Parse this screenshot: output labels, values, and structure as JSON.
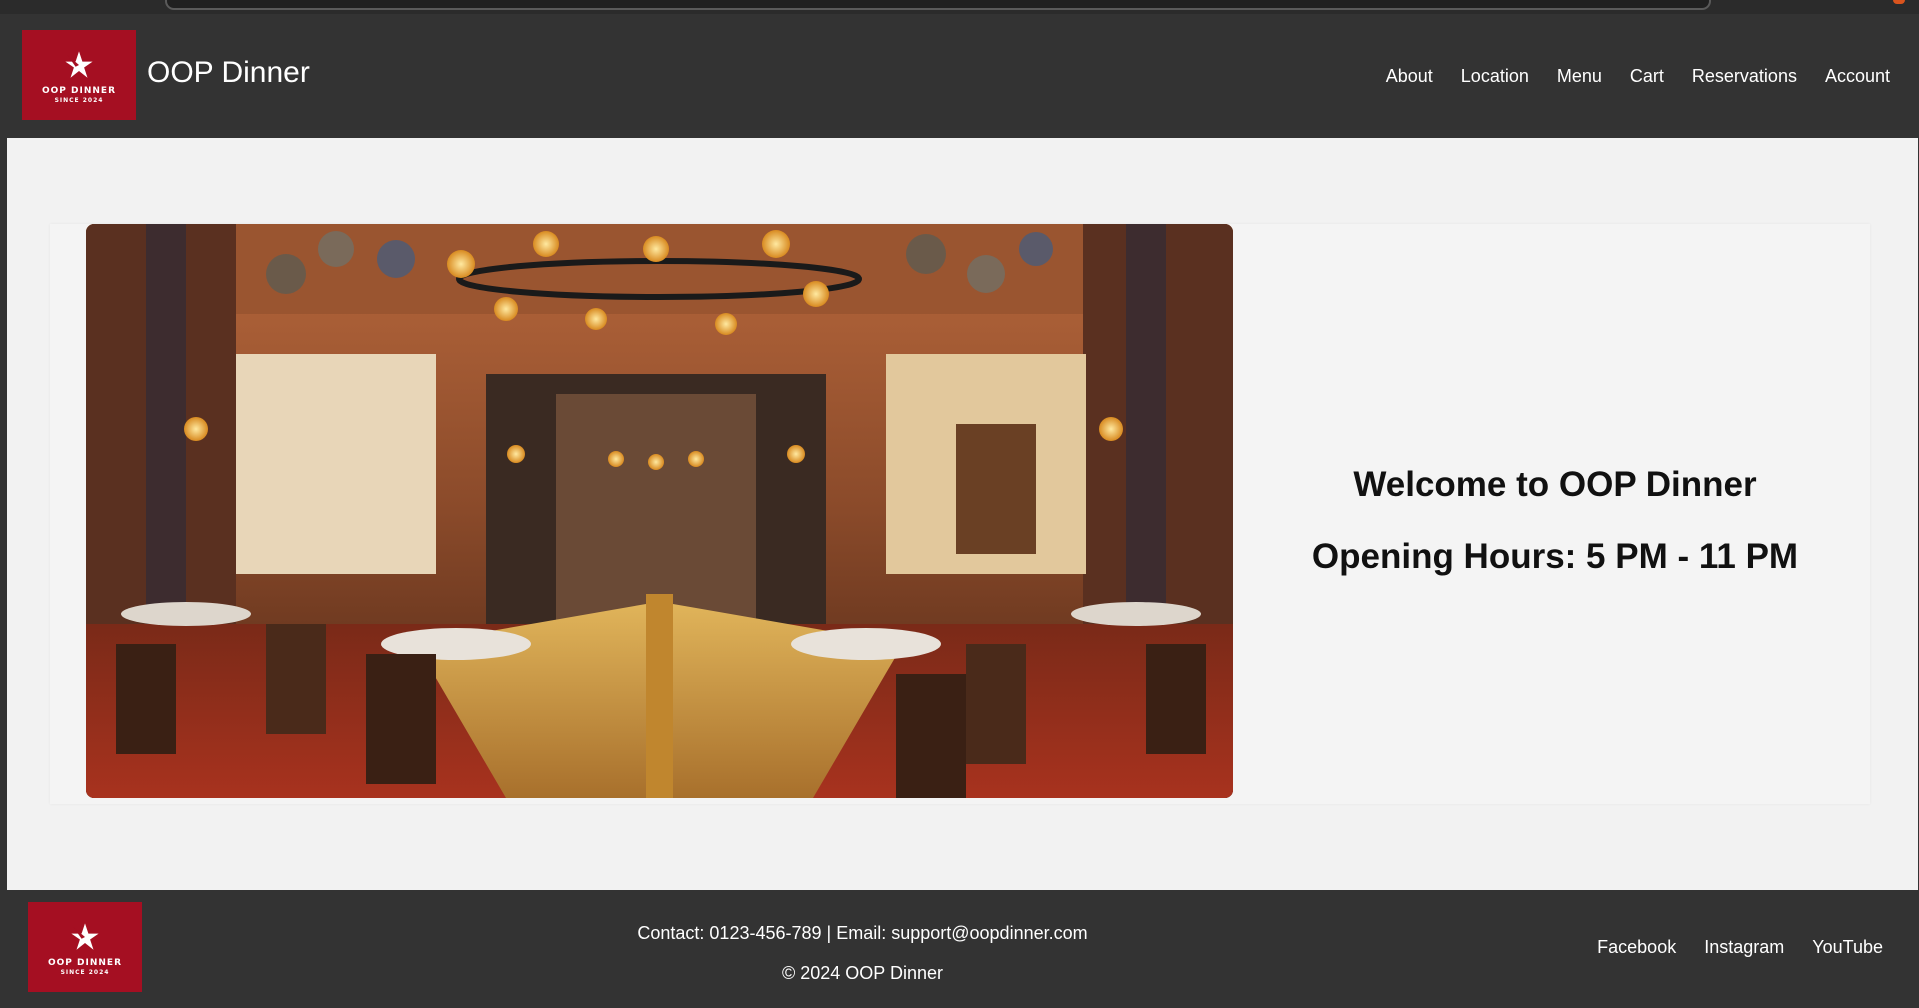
{
  "header": {
    "logo": {
      "name": "OOP DINNER",
      "since": "SINCE 2024"
    },
    "title": "OOP Dinner",
    "nav": [
      "About",
      "Location",
      "Menu",
      "Cart",
      "Reservations",
      "Account"
    ]
  },
  "hero": {
    "welcome": "Welcome to OOP Dinner",
    "hours": "Opening Hours: 5 PM - 11 PM"
  },
  "footer": {
    "logo": {
      "name": "OOP DINNER",
      "since": "SINCE 2024"
    },
    "contact": "Contact: 0123-456-789 | Email: support@oopdinner.com",
    "copyright": "© 2024 OOP Dinner",
    "social": [
      "Facebook",
      "Instagram",
      "YouTube"
    ]
  },
  "colors": {
    "header_bg": "#333333",
    "logo_bg": "#a50f22",
    "main_bg": "#f2f2f2"
  },
  "icons": [
    "plane-star-logo-icon"
  ]
}
